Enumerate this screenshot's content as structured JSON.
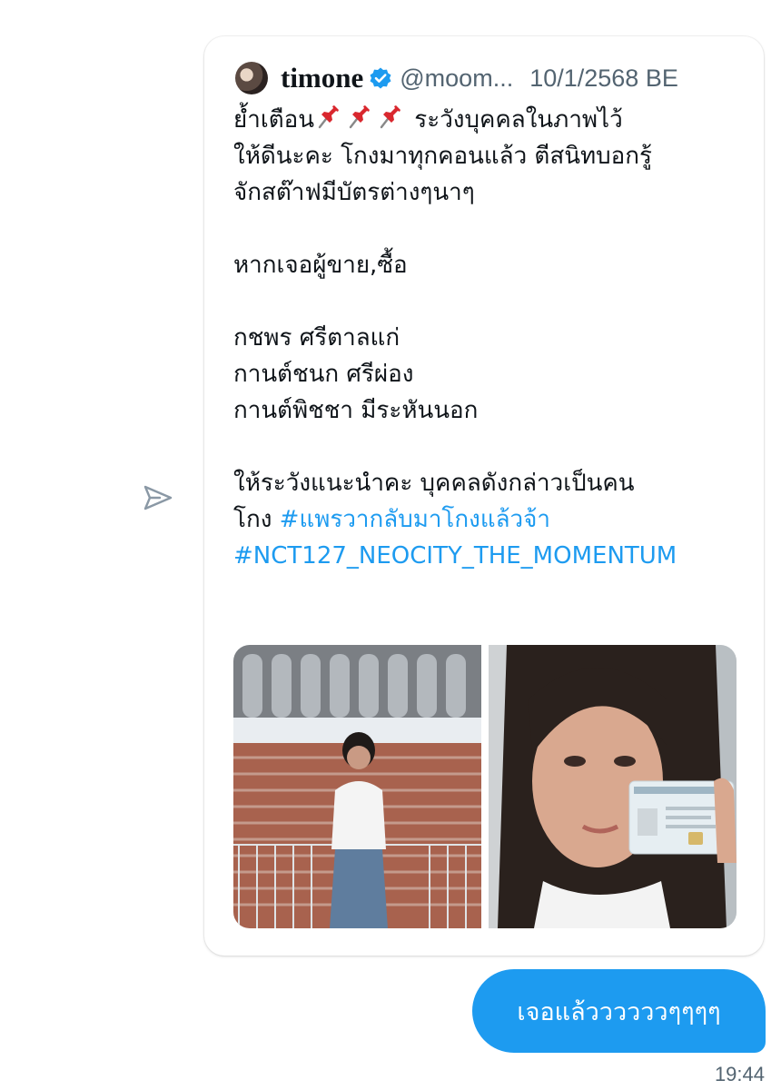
{
  "tweet": {
    "display_name": "timone",
    "handle": "@moom...",
    "date": "10/1/2568 BE",
    "lines": [
      "ย้ำเตือน",
      "ให้ดีนะคะ โกงมาทุกคอนแล้ว ตีสนิทบอกรู้",
      "จักสต๊าฟมีบัตรต่างๆนาๆ",
      "",
      "หากเจอผู้ขาย,ซื้อ",
      "",
      "กชพร ศรีตาลแก่",
      "กานต์ชนก ศรีผ่อง",
      "กานต์พิชชา มีระหันนอก",
      "",
      "ให้ระวังแนะนำคะ บุคคลดังกล่าวเป็นคน"
    ],
    "line1_rest": " ระวังบุคคลในภาพไว้",
    "line_last_prefix": "โกง ",
    "hashtag_1": "#แพรวากลับมาโกงแล้วจ้า",
    "hashtag_2": "#NCT127_NEOCITY_THE_MOMENTUM",
    "emoji_icons": [
      "pushpin-icon",
      "pushpin-icon",
      "pushpin-icon"
    ]
  },
  "message": {
    "text": "เจอแล้ววววววๆๆๆๆ",
    "time": "19:44"
  },
  "colors": {
    "bubble": "#1d9bf0",
    "hashtag": "#1d9bf0",
    "verified": "#1d9bf0",
    "secondary_text": "#536471"
  }
}
